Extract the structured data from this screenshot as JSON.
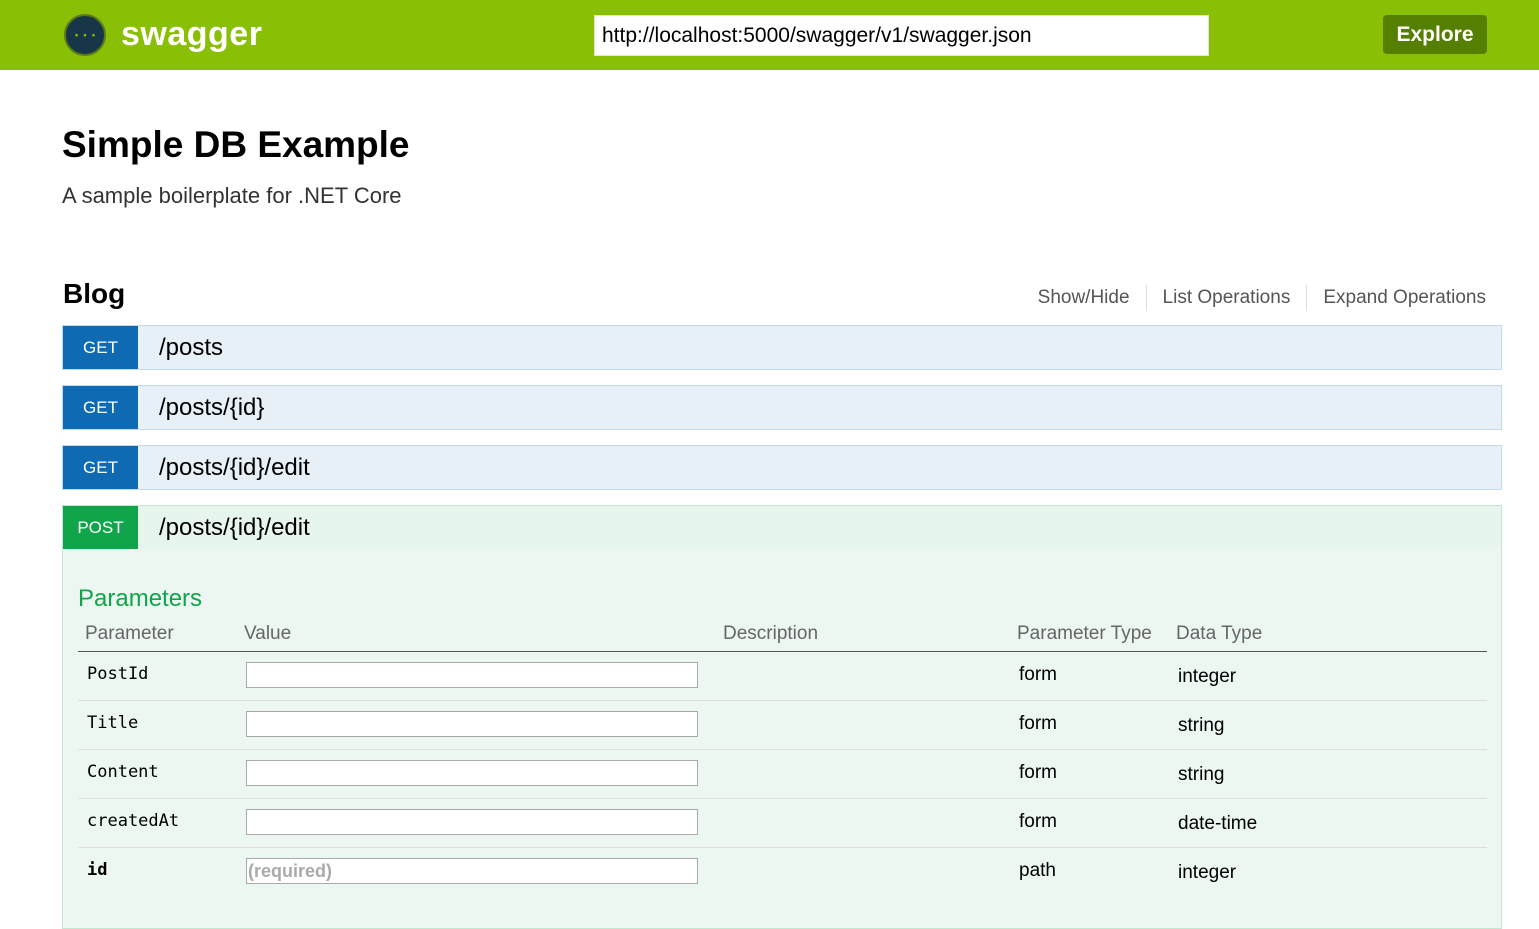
{
  "header": {
    "logo_text": "swagger",
    "url_value": "http://localhost:5000/swagger/v1/swagger.json",
    "explore_label": "Explore",
    "bar_color": "#89bf04",
    "explore_color": "#547f00"
  },
  "info": {
    "title": "Simple DB Example",
    "description": "A sample boilerplate for .NET Core"
  },
  "resource": {
    "name": "Blog",
    "links": [
      "Show/Hide",
      "List Operations",
      "Expand Operations"
    ]
  },
  "operations": [
    {
      "method": "GET",
      "path": "/posts"
    },
    {
      "method": "GET",
      "path": "/posts/{id}"
    },
    {
      "method": "GET",
      "path": "/posts/{id}/edit"
    },
    {
      "method": "POST",
      "path": "/posts/{id}/edit"
    }
  ],
  "expanded": {
    "params_heading": "Parameters",
    "columns": [
      "Parameter",
      "Value",
      "Description",
      "Parameter Type",
      "Data Type"
    ],
    "rows": [
      {
        "name": "PostId",
        "value": "",
        "placeholder": "",
        "param_type": "form",
        "data_type": "integer"
      },
      {
        "name": "Title",
        "value": "",
        "placeholder": "",
        "param_type": "form",
        "data_type": "string"
      },
      {
        "name": "Content",
        "value": "",
        "placeholder": "",
        "param_type": "form",
        "data_type": "string"
      },
      {
        "name": "createdAt",
        "value": "",
        "placeholder": "",
        "param_type": "form",
        "data_type": "date-time"
      },
      {
        "name": "id",
        "value": "",
        "placeholder": "(required)",
        "param_type": "path",
        "data_type": "integer"
      }
    ]
  },
  "colors": {
    "get": "#0f6ab4",
    "post": "#10a54a"
  }
}
